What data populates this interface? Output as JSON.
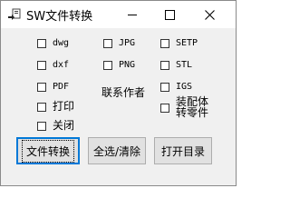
{
  "window": {
    "title": "SW文件转换"
  },
  "checkboxes": {
    "dwg": "dwg",
    "dxf": "dxf",
    "pdf": "PDF",
    "print": "打印",
    "close": "关闭",
    "jpg": "JPG",
    "png": "PNG",
    "setp": "SETP",
    "stl": "STL",
    "igs": "IGS",
    "assembly": "装配体\n转零件"
  },
  "labels": {
    "contact_author": "联系作者"
  },
  "buttons": {
    "convert": "文件转换",
    "select_all_clear": "全选/清除",
    "open_dir": "打开目录"
  }
}
